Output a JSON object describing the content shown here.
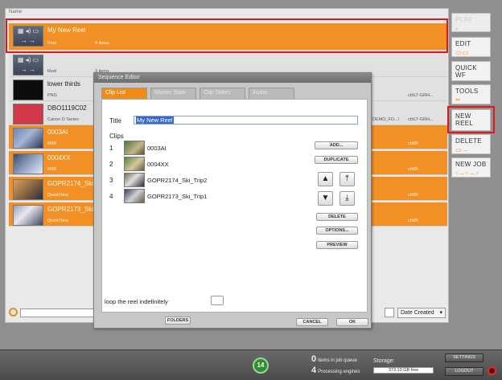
{
  "list": {
    "header": "Name",
    "rows": [
      {
        "name": "My New Reel",
        "type": "Reel",
        "items": "4 items",
        "extra": ""
      },
      {
        "name": "",
        "type": "Reel",
        "items": "3 items",
        "extra": ""
      },
      {
        "name": "lower thirds",
        "type": "PNG",
        "items": "",
        "extra": "cb\\LT-GRH..."
      },
      {
        "name": "DBO1119C02",
        "type": "Canon D Series",
        "items": "",
        "extra": "DEMO_FO...\\",
        "extra2": "cb\\LT-GRH..."
      },
      {
        "name": "0003AI",
        "type": "MXF",
        "items": "",
        "extra": "cb\\D\\"
      },
      {
        "name": "0004XX",
        "type": "MXF",
        "items": "",
        "extra": "cb\\D\\"
      },
      {
        "name": "GOPR2174_Ski_T",
        "type": "QuickTime",
        "items": "",
        "extra": "cb\\D\\"
      },
      {
        "name": "GOPR2173_Ski_T",
        "type": "QuickTime",
        "items": "",
        "extra": "cb\\D\\"
      }
    ]
  },
  "sidebar": {
    "play": "PLAY",
    "edit": "EDIT",
    "quick_wf": "QUICK WF",
    "tools": "TOOLS",
    "new_reel": "NEW REEL",
    "delete": "DELETE",
    "new_job": "NEW JOB"
  },
  "search": {
    "placeholder": ""
  },
  "sort": {
    "selected": "Date Created"
  },
  "dialog": {
    "title": "Sequence Editor",
    "tabs": [
      "Clip List",
      "Master Slate",
      "Clip Slates",
      "Audio"
    ],
    "title_label": "Title",
    "title_value": "My New Reel",
    "clips_label": "Clips",
    "clips": [
      {
        "num": "1",
        "name": "0003AI"
      },
      {
        "num": "2",
        "name": "0004XX"
      },
      {
        "num": "3",
        "name": "GOPR2174_Ski_Trip2"
      },
      {
        "num": "4",
        "name": "GOPR2173_Ski_Trip1"
      }
    ],
    "add": "ADD...",
    "duplicate": "DUPLICATE",
    "delete": "DELETE",
    "options": "OPTIONS...",
    "preview": "PREVIEW",
    "loop_label": "loop the reel indefinitely",
    "folders": "FOLDERS",
    "cancel": "CANCEL",
    "ok": "OK"
  },
  "status": {
    "jobs_count": "14",
    "queue_count": "0",
    "queue_label": "items in job queue",
    "engines_count": "4",
    "engines_label": "Processing engines",
    "storage_label": "Storage:",
    "storage_value": "373.10 GB free"
  },
  "bottom_buttons": {
    "settings": "SETTINGS",
    "logout": "LOGOUT"
  },
  "colors": {
    "accent": "#f39025",
    "highlight": "#e0161e"
  }
}
